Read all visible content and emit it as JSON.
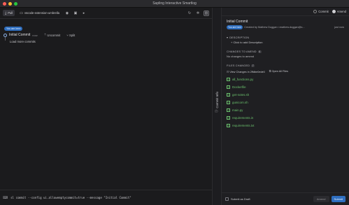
{
  "window": {
    "title": "Sapling Interactive Smartlog",
    "traffic_colors": [
      "#ff5f57",
      "#febc2e",
      "#28c840"
    ]
  },
  "toolbar": {
    "pull_label": "Pull",
    "repo_label": "vscode-extension-umbrella"
  },
  "graph": {
    "here_badge": "You are here",
    "commit": {
      "title": "Initial Commit",
      "time": "now",
      "uncommit_label": "Uncommit",
      "split_label": "Split"
    },
    "load_more": "Load more commits"
  },
  "command_bar": {
    "text": "sl commit --config ui.allowemptycommit=true --message \"Initial Commit\""
  },
  "side_strip": {
    "label": "Commit Info"
  },
  "right_panel": {
    "mode_options": [
      {
        "label": "Commit",
        "selected": false
      },
      {
        "label": "Amend",
        "selected": true
      }
    ],
    "title": "Initial Commit",
    "meta_badge": "You are here",
    "author": "Created by Mathew Duggan <mathew.duggan@s...",
    "time": "just now",
    "description_head": "DESCRIPTION",
    "description_add": "Click to add Description",
    "changes_head": "CHANGES TO AMEND",
    "changes_count": "0",
    "no_changes": "No changes to amend",
    "files_head": "FILES CHANGED",
    "files_count": "7",
    "view_changes": "View Changes in 2ffdbe0ede0",
    "open_all": "Open All Files",
    "files": [
      "all_functions.py",
      "Dockerfile",
      "get-notes.sh",
      "gunicorn.sh",
      "main.py",
      "requirements.in",
      "requirements.txt"
    ]
  },
  "footer": {
    "draft_label": "Submit as Draft",
    "amend_label": "Amend",
    "submit_label": "Submit"
  },
  "colors": {
    "accent": "#2f6fc0",
    "file_added": "#6cc36e",
    "background": "#1b1b1d"
  }
}
